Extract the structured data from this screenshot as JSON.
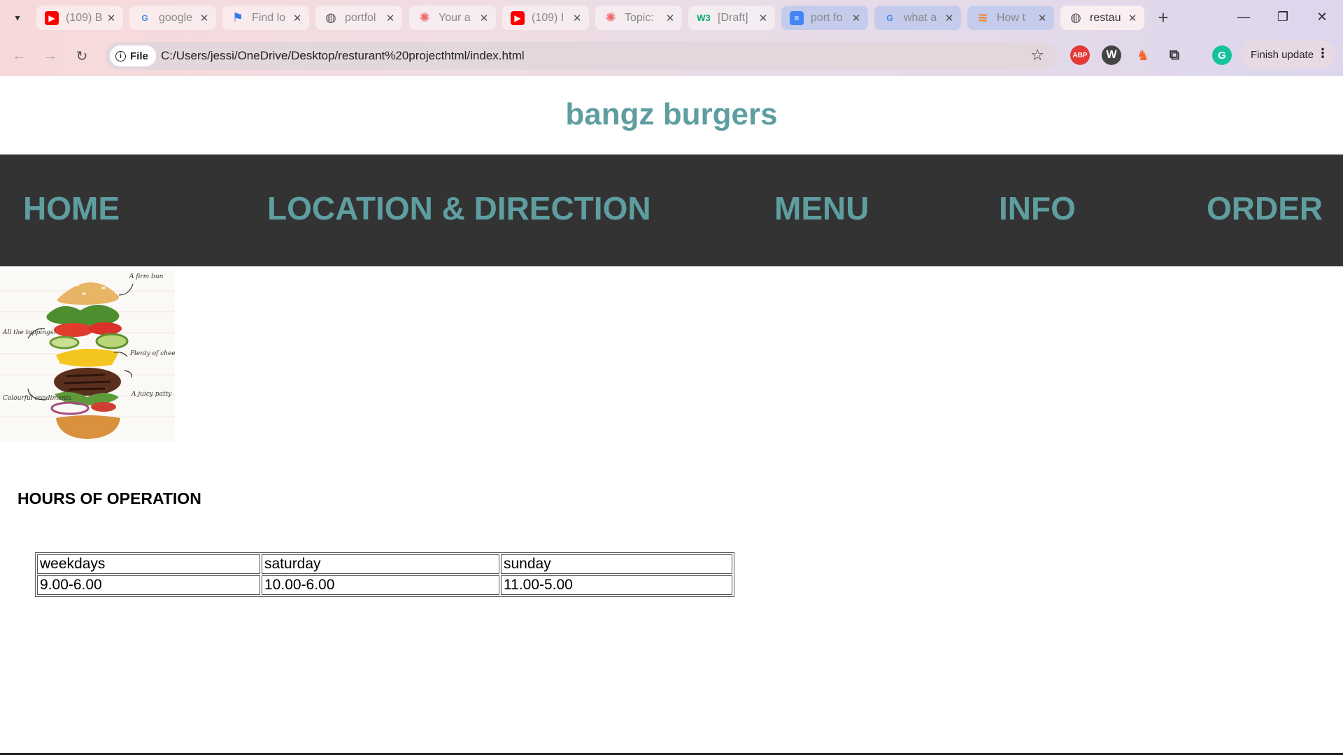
{
  "browser": {
    "tabs": [
      {
        "title": "(109) B",
        "icon": "youtube-icon",
        "color": "#ff0000"
      },
      {
        "title": "google",
        "icon": "google-icon",
        "color": "#4285f4"
      },
      {
        "title": "Find lo",
        "icon": "flag-icon",
        "color": "#3b78e7"
      },
      {
        "title": "portfol",
        "icon": "globe-icon",
        "color": "#555555"
      },
      {
        "title": "Your a",
        "icon": "asana-icon",
        "color": "#f06a6a"
      },
      {
        "title": "(109) I",
        "icon": "youtube-icon",
        "color": "#ff0000"
      },
      {
        "title": "Topic:",
        "icon": "asana-icon",
        "color": "#f06a6a"
      },
      {
        "title": "[Draft]",
        "icon": "w3schools-icon",
        "color": "#04aa6d"
      },
      {
        "title": "port fo",
        "icon": "docs-icon",
        "color": "#4285f4"
      },
      {
        "title": "what a",
        "icon": "google-icon",
        "color": "#4285f4"
      },
      {
        "title": "How t",
        "icon": "stackoverflow-icon",
        "color": "#f48024"
      },
      {
        "title": "restau",
        "icon": "globe-icon",
        "color": "#555555"
      }
    ],
    "fav_glyphs": {
      "youtube-icon": "▶",
      "google-icon": "G",
      "flag-icon": "⚑",
      "globe-icon": "◍",
      "asana-icon": "✺",
      "w3schools-icon": "W3",
      "docs-icon": "≡",
      "stackoverflow-icon": "≋"
    },
    "url_chip_label": "File",
    "url": "C:/Users/jessi/OneDrive/Desktop/resturant%20projecthtml/index.html",
    "update_label": "Finish update",
    "extensions": [
      "adblock-icon",
      "wordpress-icon",
      "bug-icon",
      "puzzle-icon",
      "grammarly-icon"
    ]
  },
  "site": {
    "title": "bangz burgers",
    "brand_color": "#5f9ea0",
    "nav_bg": "#333333",
    "nav": [
      "HOME",
      "LOCATION & DIRECTION",
      "MENU",
      "INFO",
      "ORDER"
    ],
    "image_annotations": [
      "A firm bun",
      "All the toppings!",
      "Plenty of cheese",
      "A juicy patty",
      "Colourful condiments"
    ],
    "hours_heading": "HOURS OF OPERATION",
    "hours": {
      "headers": [
        "weekdays",
        "saturday",
        "sunday"
      ],
      "values": [
        "9.00-6.00",
        "10.00-6.00",
        "11.00-5.00"
      ]
    }
  }
}
